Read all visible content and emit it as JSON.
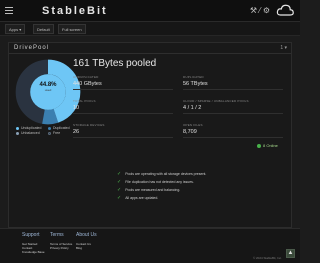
{
  "app": {
    "brand": "StableBit"
  },
  "header": {
    "tools_label": "⚒ ⁄ ⚙",
    "cloud_icon": "cloud-icon"
  },
  "toolbar": {
    "apps_label": "Apps ▾",
    "default_label": "Default",
    "fullscreen_label": "Full screen"
  },
  "panel": {
    "title": "DrivePool",
    "badge": "1 ▾",
    "pooled_title": "161 TBytes pooled",
    "donut": {
      "percent_label": "44.8%",
      "sub_label": "used",
      "duplicated_fraction": 0.448,
      "unduplicated_fraction": 0.08
    },
    "legend": {
      "unduplicated": "Unduplicated",
      "duplicated": "Duplicated",
      "other": "Unbalanced",
      "free": "Free"
    },
    "stats": [
      {
        "label": "UNDUPLICATED",
        "value": "440 GBytes"
      },
      {
        "label": "DUPLICATED",
        "value": "56 TBytes"
      },
      {
        "label": "TOTAL POOLS",
        "value": "10"
      },
      {
        "label": "CLOUD / SPARSE / UNBALANCED POOLS",
        "value": "4 / 1 / 2"
      },
      {
        "label": "STORAGE DEVICES",
        "value": "26"
      },
      {
        "label": "OPEN FILES",
        "value": "8,709"
      }
    ],
    "ok_label": "8 Online",
    "checks": [
      "Pools are operating with all storage devices present.",
      "File duplication has not detected any issues.",
      "Pools are measured and balancing.",
      "All apps are updated."
    ]
  },
  "footer": {
    "support": {
      "heading": "Support",
      "links": [
        "Get Started",
        "Contact",
        "Knowledge Base"
      ]
    },
    "terms": {
      "heading": "Terms",
      "links": [
        "Terms of Service",
        "Privacy Policy"
      ]
    },
    "about": {
      "heading": "About Us",
      "links": [
        "Contact Us",
        "Blog"
      ]
    },
    "copyright": "© 2024 StableBit, Inc."
  },
  "colors": {
    "accent_blue": "#6ec6f5",
    "ok_green": "#4fb84f",
    "ring_dark": "#2a3340"
  }
}
